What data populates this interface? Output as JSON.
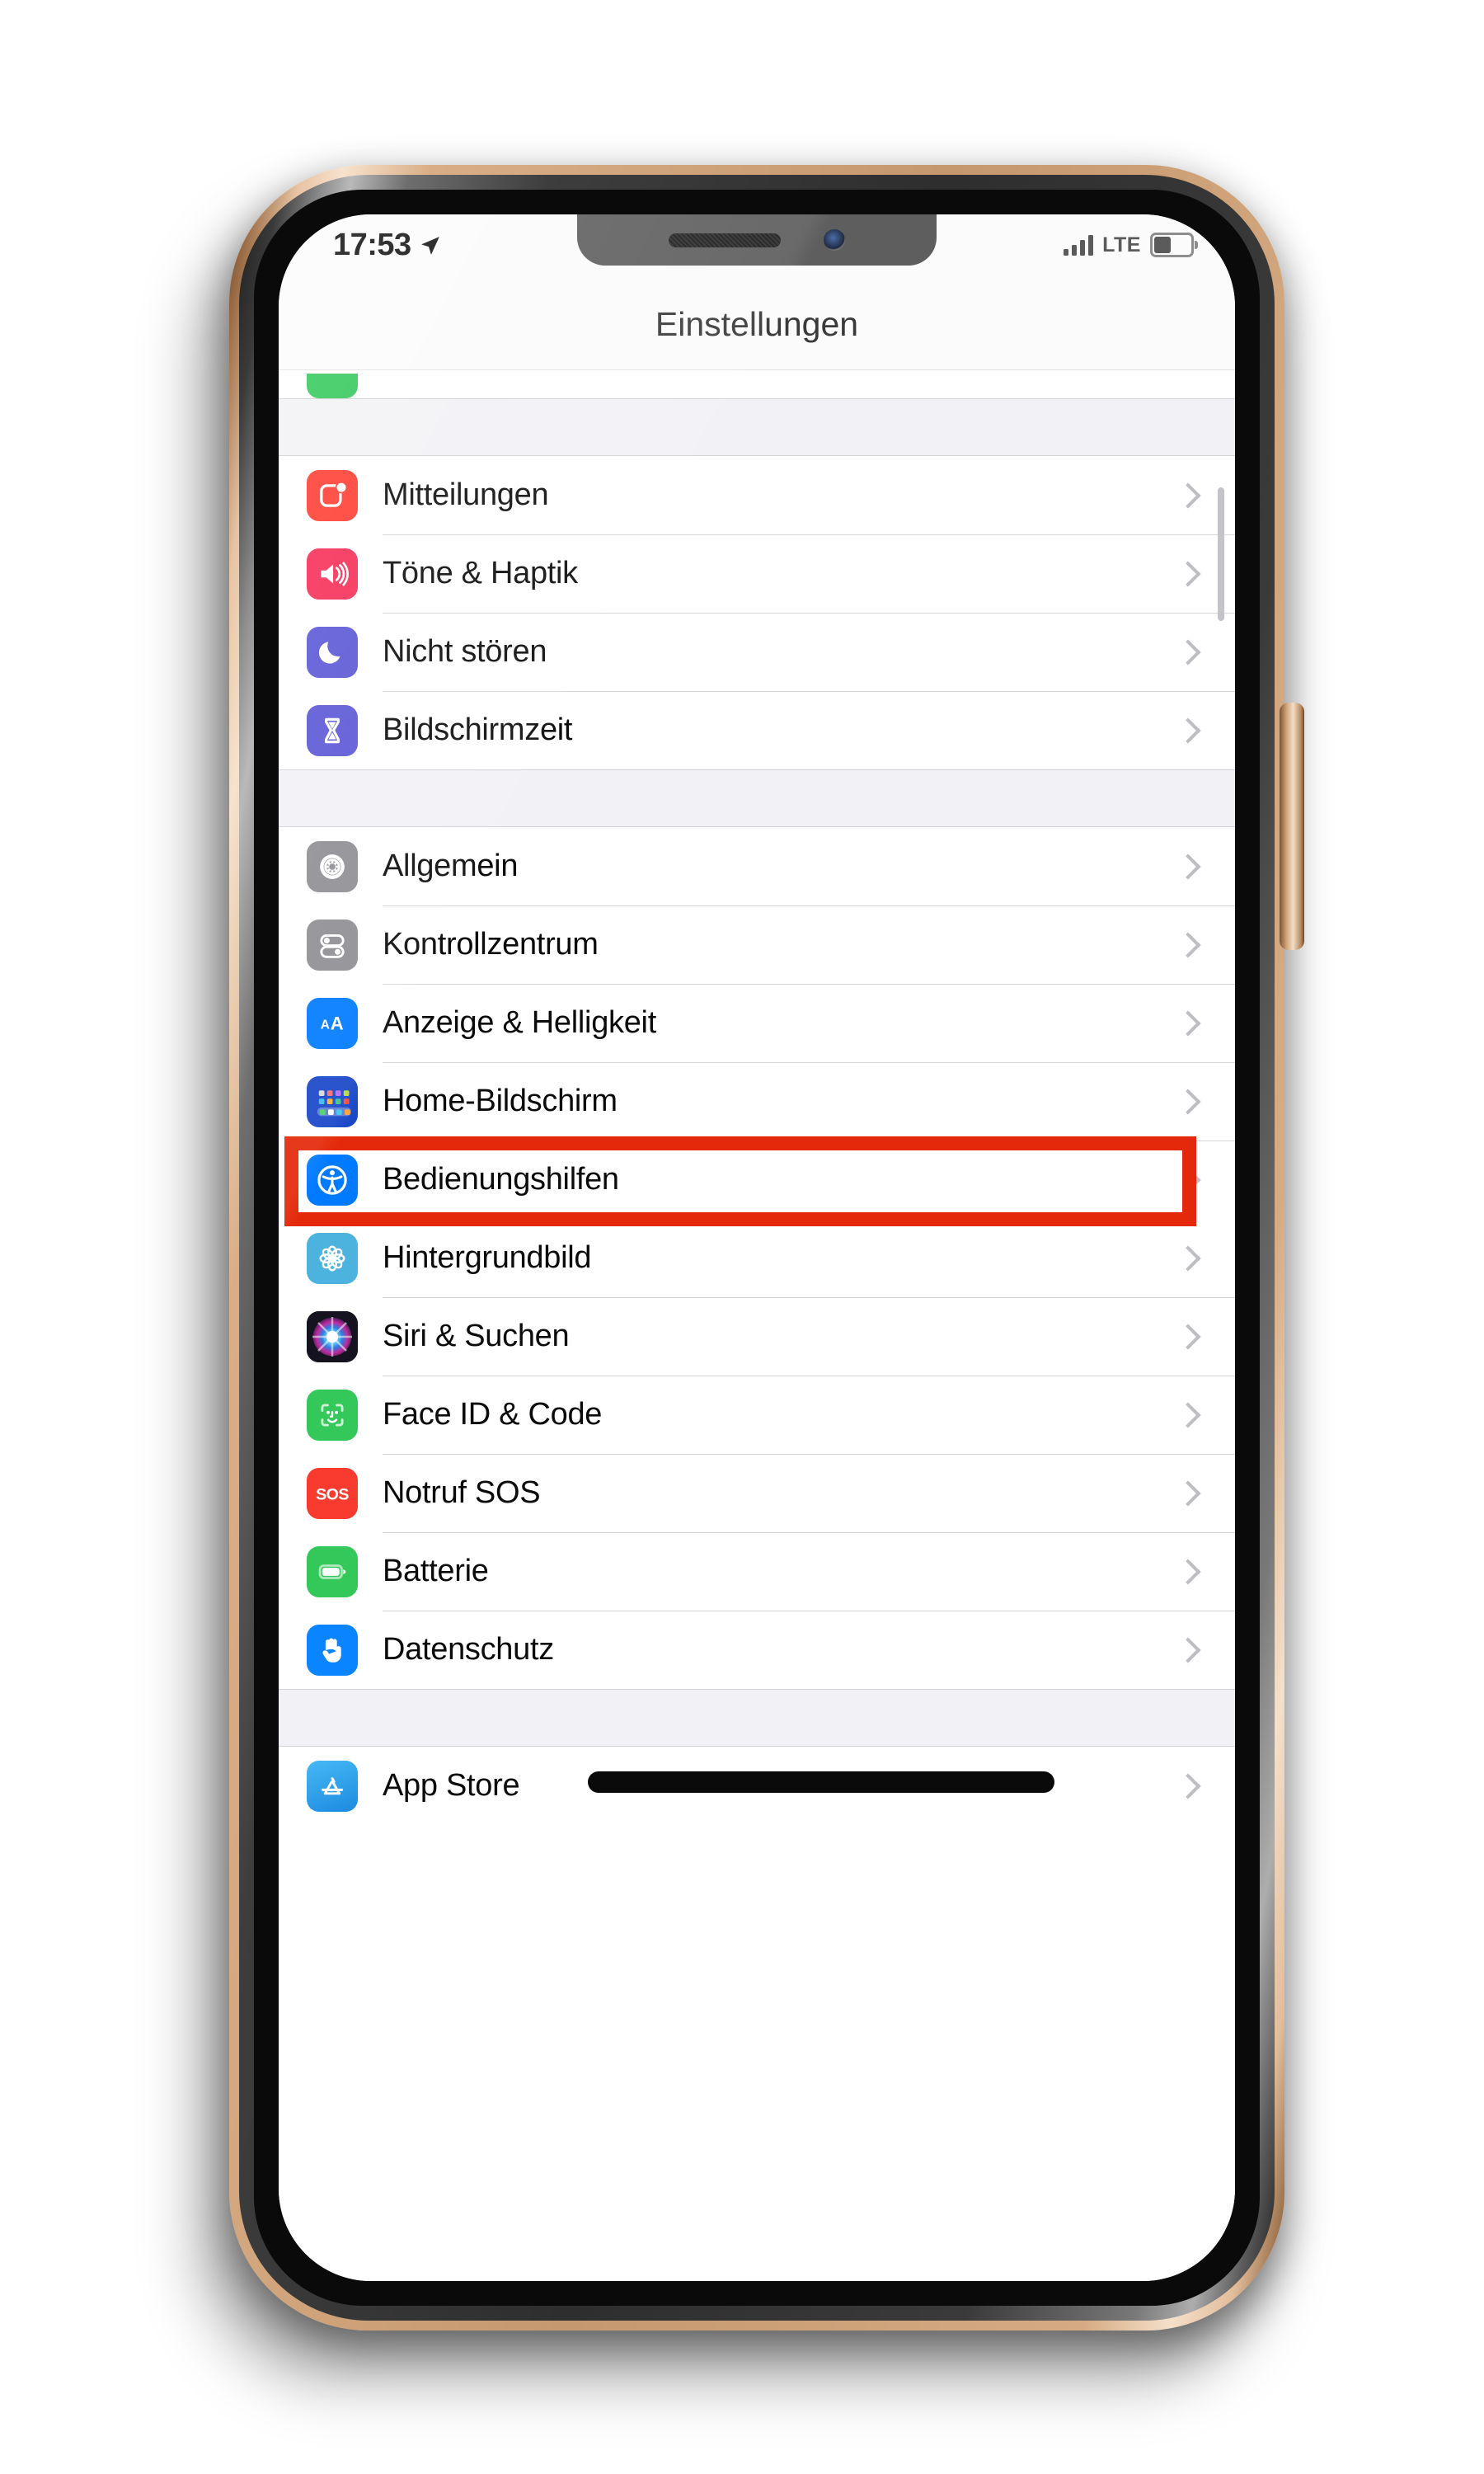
{
  "device": {
    "frame_color": "#c6986f",
    "screen_bg": "#ffffff"
  },
  "status_bar": {
    "time": "17:53",
    "location_icon": "location-arrow-icon",
    "signal_icon": "cellular-signal-icon",
    "signal_bars": 4,
    "carrier_tech": "LTE",
    "battery_icon": "battery-icon",
    "battery_level_percent": 43
  },
  "nav": {
    "title": "Einstellungen"
  },
  "highlight": {
    "color": "#e4290a",
    "target_row": "Bedienungshilfen"
  },
  "list": {
    "partial_top_row": {
      "icon": "phone-green-icon",
      "color": "#32c85a"
    },
    "groups": [
      {
        "id": "group-notifications",
        "rows": [
          {
            "label": "Mitteilungen",
            "icon": "notifications-icon",
            "color": "#ff3b30",
            "chevron": "chevron-right-icon"
          },
          {
            "label": "Töne & Haptik",
            "icon": "sounds-haptics-icon",
            "color": "#f62c55",
            "chevron": "chevron-right-icon"
          },
          {
            "label": "Nicht stören",
            "icon": "do-not-disturb-icon",
            "color": "#5a56d6",
            "chevron": "chevron-right-icon"
          },
          {
            "label": "Bildschirmzeit",
            "icon": "screen-time-icon",
            "color": "#5a56d6",
            "chevron": "chevron-right-icon"
          }
        ]
      },
      {
        "id": "group-general",
        "rows": [
          {
            "label": "Allgemein",
            "icon": "gear-icon",
            "color": "#8e8e93",
            "chevron": "chevron-right-icon"
          },
          {
            "label": "Kontrollzentrum",
            "icon": "control-center-icon",
            "color": "#8e8e93",
            "chevron": "chevron-right-icon"
          },
          {
            "label": "Anzeige & Helligkeit",
            "icon": "display-brightness-icon",
            "color": "#007aff",
            "chevron": "chevron-right-icon"
          },
          {
            "label": "Home-Bildschirm",
            "icon": "home-screen-icon",
            "color": "#1a47c8",
            "chevron": "chevron-right-icon"
          },
          {
            "label": "Bedienungshilfen",
            "icon": "accessibility-icon",
            "color": "#007aff",
            "chevron": "chevron-right-icon",
            "highlighted": true
          },
          {
            "label": "Hintergrundbild",
            "icon": "wallpaper-icon",
            "color": "#4bb3dd",
            "chevron": "chevron-right-icon"
          },
          {
            "label": "Siri & Suchen",
            "icon": "siri-icon",
            "color": "#1b1b2b",
            "chevron": "chevron-right-icon"
          },
          {
            "label": "Face ID & Code",
            "icon": "face-id-icon",
            "color": "#34c759",
            "chevron": "chevron-right-icon"
          },
          {
            "label": "Notruf SOS",
            "icon": "sos-icon",
            "color": "#f93b2f",
            "chevron": "chevron-right-icon"
          },
          {
            "label": "Batterie",
            "icon": "battery-settings-icon",
            "color": "#34c759",
            "chevron": "chevron-right-icon"
          },
          {
            "label": "Datenschutz",
            "icon": "privacy-hand-icon",
            "color": "#0a84ff",
            "chevron": "chevron-right-icon"
          }
        ]
      },
      {
        "id": "group-store",
        "rows": [
          {
            "label": "App Store",
            "icon": "app-store-icon",
            "color": "#2aa8f2",
            "chevron": "chevron-right-icon",
            "redacted": true
          }
        ]
      }
    ]
  }
}
